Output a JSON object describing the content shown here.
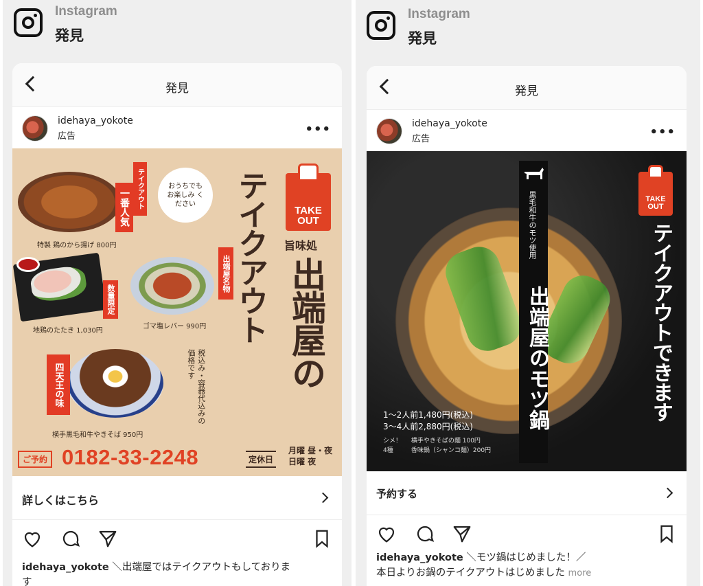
{
  "left": {
    "brand": "Instagram",
    "section": "発見",
    "nav_title": "発見",
    "username": "idehaya_yokote",
    "ad_label": "広告",
    "ad": {
      "takeout_label": "TAKE OUT",
      "kicker": "旨味処",
      "title_1": "出端屋の",
      "title_2": "テイクアウト",
      "bubble": "おうちでも お楽しみ ください",
      "tag_takeout_popular_1": "テイクアウト",
      "tag_takeout_popular_2": "一番人気",
      "tag_limited": "数量限定",
      "tag_specialty": "出端屋名物",
      "tag_shitenno": "四天王の味",
      "note": "税込み・容器代込みの価格です",
      "item_1": "特製 鶏のから揚げ 800円",
      "item_2": "地鶏のたたき 1,030円",
      "item_3": "ゴマ塩レバー 990円",
      "item_4": "横手黒毛和牛やきそば 950円",
      "reserve_label": "ご予約",
      "phone": "0182-33-2248",
      "closed_label": "定休日",
      "closed_days_1": "月曜 昼・夜",
      "closed_days_2": "日曜 夜"
    },
    "cta": "詳しくはこちら",
    "caption_user": "idehaya_yokote",
    "caption_text": "＼出端屋ではテイクアウトもしておりま",
    "caption_line2": "す"
  },
  "right": {
    "brand": "Instagram",
    "section": "発見",
    "nav_title": "発見",
    "username": "idehaya_yokote",
    "ad_label": "広告",
    "ad": {
      "takeout_label": "TAKE OUT",
      "side_text": "テイクアウトできます",
      "banner_small": "黒毛和牛のモツ使用",
      "banner_big": "出端屋のモツ鍋",
      "price_1": "1〜2人前1,480円(税込)",
      "price_2": "3〜4人前2,880円(税込)",
      "shime_label": "シメ！",
      "shime_options": "4種",
      "shime_1": "横手やきそばの麺 100円",
      "shime_2": "香味鍋（シャンコ麺）200円"
    },
    "cta": "予約する",
    "caption_user": "idehaya_yokote",
    "caption_text": "＼モツ鍋はじめました！／",
    "caption_line2": "本日よりお鍋のテイクアウトはじめました",
    "more": "more"
  },
  "colors": {
    "accent_red": "#e04224",
    "kraft": "#e9cfae",
    "dark_bg": "#1c1c1c"
  }
}
